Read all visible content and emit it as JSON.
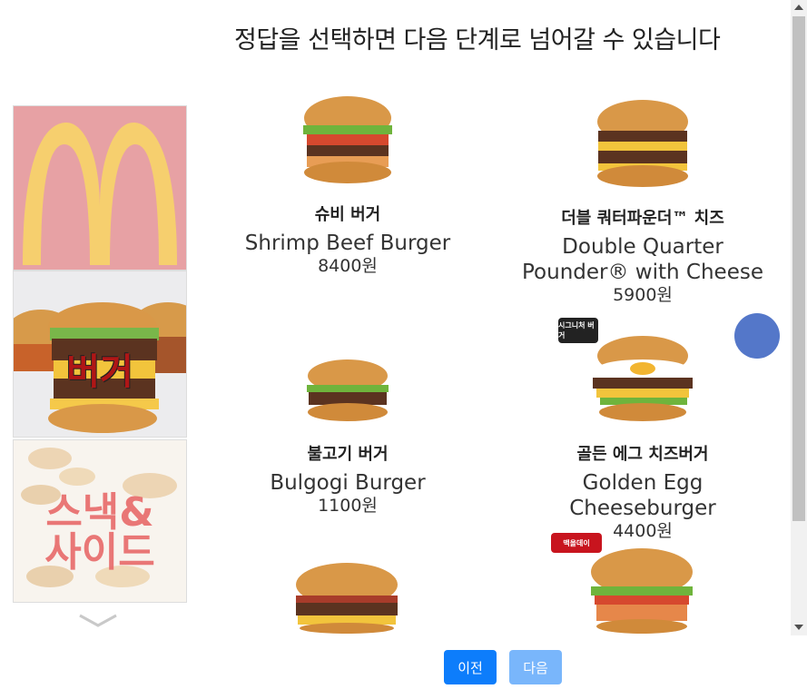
{
  "header": {
    "title": "정답을 선택하면 다음 단계로 넘어갈 수 있습니다"
  },
  "categories": [
    {
      "name": "mcdonalds-logo",
      "label": ""
    },
    {
      "name": "burger",
      "label": "버거"
    },
    {
      "name": "snack-side",
      "label": "스낵&\n사이드"
    }
  ],
  "products": [
    {
      "name_ko": "슈비 버거",
      "name_en": "Shrimp Beef Burger",
      "price": "8400원"
    },
    {
      "name_ko": "더블 쿼터파운더™ 치즈",
      "name_en": "Double Quarter Pounder® with Cheese",
      "price": "5900원"
    },
    {
      "name_ko": "불고기 버거",
      "name_en": "Bulgogi Burger",
      "price": "1100원"
    },
    {
      "name_ko": "골든 에그 치즈버거",
      "name_en": "Golden Egg Cheeseburger",
      "price": "4400원"
    }
  ],
  "badges": {
    "signature": "시그니처 버거",
    "happy": "맥올데이"
  },
  "buttons": {
    "prev": "이전",
    "next": "다음"
  },
  "colors": {
    "prev_button": "#0d7dfb",
    "next_button": "#79b6fb",
    "floating_button": "#5477c9",
    "accent_red": "#b01616"
  }
}
